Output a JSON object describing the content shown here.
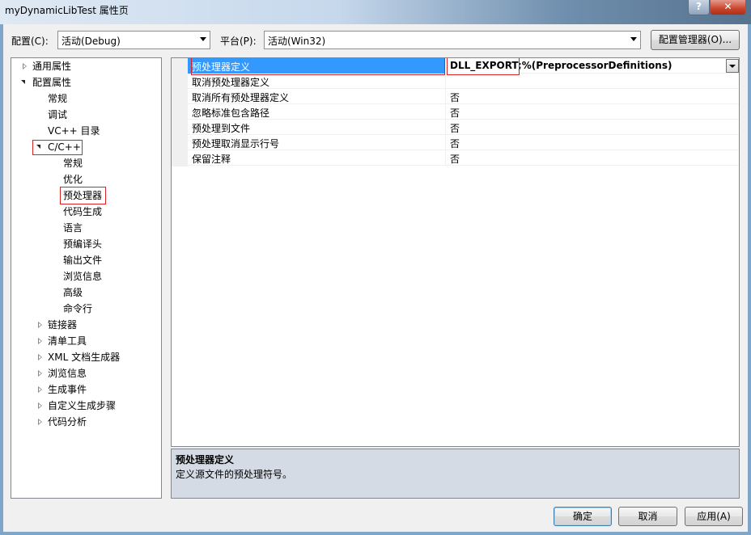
{
  "window": {
    "title": "myDynamicLibTest 属性页",
    "help_glyph": "?",
    "close_glyph": "✕"
  },
  "toolbar": {
    "config_label": "配置(C):",
    "config_value": "活动(Debug)",
    "platform_label": "平台(P):",
    "platform_value": "活动(Win32)",
    "config_manager_button": "配置管理器(O)..."
  },
  "tree": {
    "items": [
      {
        "label": "通用属性",
        "state": "collapsed"
      },
      {
        "label": "配置属性",
        "state": "expanded"
      },
      {
        "label": "常规"
      },
      {
        "label": "调试"
      },
      {
        "label": "VC++ 目录"
      },
      {
        "label": "C/C++",
        "state": "expanded"
      },
      {
        "label": "常规"
      },
      {
        "label": "优化"
      },
      {
        "label": "预处理器",
        "selected": true
      },
      {
        "label": "代码生成"
      },
      {
        "label": "语言"
      },
      {
        "label": "预编译头"
      },
      {
        "label": "输出文件"
      },
      {
        "label": "浏览信息"
      },
      {
        "label": "高级"
      },
      {
        "label": "命令行"
      },
      {
        "label": "链接器",
        "state": "collapsed"
      },
      {
        "label": "清单工具",
        "state": "collapsed"
      },
      {
        "label": "XML 文档生成器",
        "state": "collapsed"
      },
      {
        "label": "浏览信息",
        "state": "collapsed"
      },
      {
        "label": "生成事件",
        "state": "collapsed"
      },
      {
        "label": "自定义生成步骤",
        "state": "collapsed"
      },
      {
        "label": "代码分析",
        "state": "collapsed"
      }
    ]
  },
  "grid": {
    "rows": [
      {
        "name": "预处理器定义",
        "value": "DLL_EXPORT;%(PreprocessorDefinitions)",
        "selected": true
      },
      {
        "name": "取消预处理器定义",
        "value": ""
      },
      {
        "name": "取消所有预处理器定义",
        "value": "否"
      },
      {
        "name": "忽略标准包含路径",
        "value": "否"
      },
      {
        "name": "预处理到文件",
        "value": "否"
      },
      {
        "name": "预处理取消显示行号",
        "value": "否"
      },
      {
        "name": "保留注释",
        "value": "否"
      }
    ]
  },
  "description": {
    "title": "预处理器定义",
    "text": "定义源文件的预处理符号。"
  },
  "buttons": {
    "ok": "确定",
    "cancel": "取消",
    "apply": "应用(A)"
  },
  "colors": {
    "selection": "#3399ff",
    "highlight_box": "#d72323",
    "description_bg": "#d5dbe4"
  }
}
